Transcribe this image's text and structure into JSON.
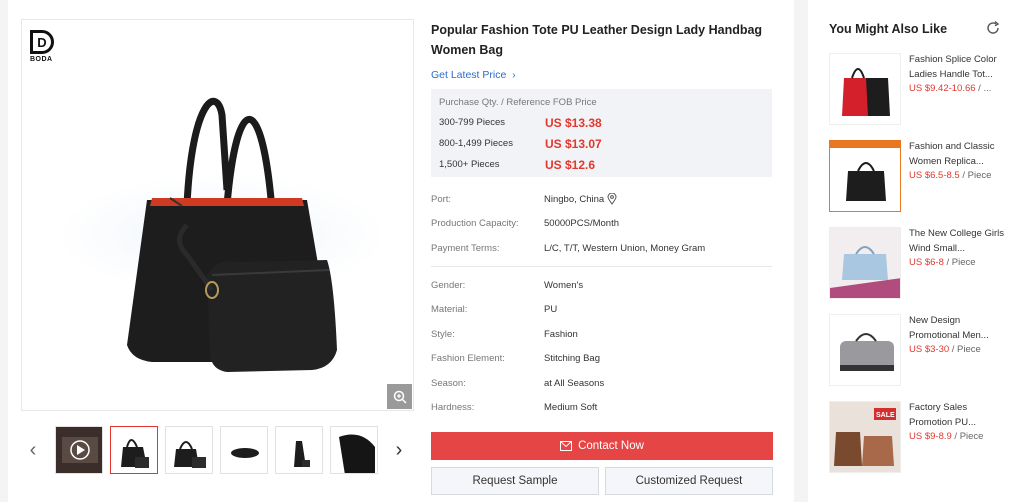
{
  "product": {
    "title": "Popular Fashion Tote PU Leather Design Lady Handbag Women Bag",
    "latest_price_link": "Get Latest Price",
    "brand_logo_text": "BODA"
  },
  "pricing": {
    "header": "Purchase Qty. / Reference FOB Price",
    "tiers": [
      {
        "qty": "300-799 Pieces",
        "price": "US $13.38"
      },
      {
        "qty": "800-1,499 Pieces",
        "price": "US $13.07"
      },
      {
        "qty": "1,500+ Pieces",
        "price": "US $12.6"
      }
    ]
  },
  "trade_info": [
    {
      "label": "Port:",
      "value": "Ningbo, China"
    },
    {
      "label": "Production Capacity:",
      "value": "50000PCS/Month"
    },
    {
      "label": "Payment Terms:",
      "value": "L/C, T/T, Western Union, Money Gram"
    }
  ],
  "attributes": [
    {
      "label": "Gender:",
      "value": "Women's"
    },
    {
      "label": "Material:",
      "value": "PU"
    },
    {
      "label": "Style:",
      "value": "Fashion"
    },
    {
      "label": "Fashion Element:",
      "value": "Stitching Bag"
    },
    {
      "label": "Season:",
      "value": "at All Seasons"
    },
    {
      "label": "Hardness:",
      "value": "Medium Soft"
    }
  ],
  "actions": {
    "contact": "Contact Now",
    "request_sample": "Request Sample",
    "customized_request": "Customized Request"
  },
  "recommendations": {
    "title": "You Might Also Like",
    "items": [
      {
        "name": "Fashion Splice Color Ladies Handle Tot...",
        "price": "US $9.42-10.66",
        "unit": " / ..."
      },
      {
        "name": "Fashion and Classic Women Replica...",
        "price": "US $6.5-8.5",
        "unit": " / Piece"
      },
      {
        "name": "The New College Girls Wind Small...",
        "price": "US $6-8",
        "unit": " / Piece"
      },
      {
        "name": "New Design Promotional Men...",
        "price": "US $3-30",
        "unit": " / Piece"
      },
      {
        "name": "Factory Sales Promotion PU...",
        "price": "US $9-8.9",
        "unit": " / Piece"
      }
    ]
  },
  "colors": {
    "accent_red": "#e3372e",
    "link_blue": "#2a6dc9",
    "contact_button": "#e64545"
  },
  "icons": [
    "zoom-in-icon",
    "chevron-left-icon",
    "chevron-right-icon",
    "location-pin-icon",
    "mail-icon",
    "refresh-icon",
    "play-icon"
  ]
}
